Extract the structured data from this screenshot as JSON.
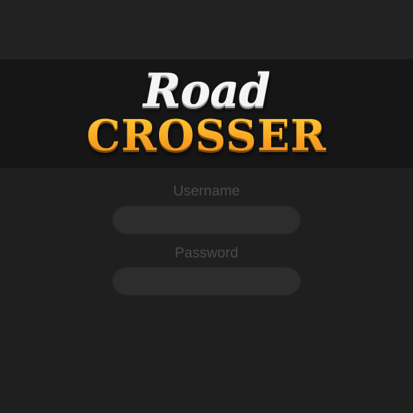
{
  "logo": {
    "line1": "Road",
    "line2": "CROSSER"
  },
  "login": {
    "username_label": "Username",
    "username_value": "",
    "password_label": "Password",
    "password_value": ""
  },
  "colors": {
    "background": "#1f1f1f",
    "logo_band": "#161616",
    "field_fill": "#2d2d2d",
    "label_text": "#4a4a4a",
    "logo_accent": "#f8a724"
  }
}
